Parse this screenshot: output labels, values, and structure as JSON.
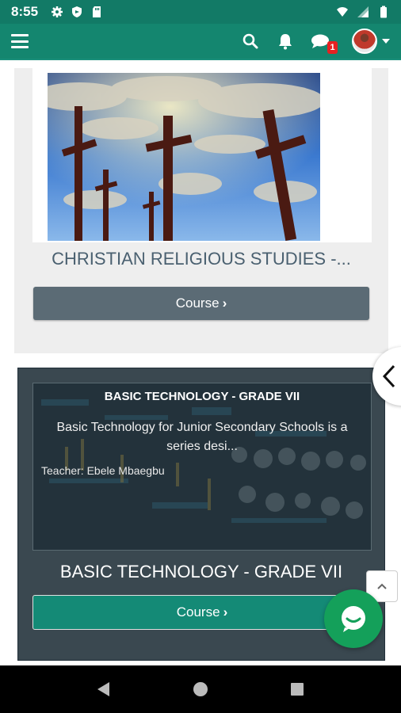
{
  "status_bar": {
    "time": "8:55"
  },
  "header": {
    "message_badge": "1"
  },
  "courses": [
    {
      "title": "CHRISTIAN RELIGIOUS STUDIES -...",
      "button_label": "Course"
    },
    {
      "title": "BASIC TECHNOLOGY - GRADE VII",
      "overlay_title": "BASIC TECHNOLOGY - GRADE VII",
      "overlay_description": "Basic Technology for Junior Secondary Schools is a series desi...",
      "overlay_teacher": "Teacher: Ebele Mbaegbu",
      "button_label": "Course"
    }
  ],
  "icons": {
    "status": [
      "settings-icon",
      "shield-icon",
      "sd-card-icon",
      "wifi-icon",
      "signal-icon",
      "battery-icon"
    ],
    "header": [
      "menu-icon",
      "search-icon",
      "bell-icon",
      "chat-icon",
      "avatar",
      "caret-down-icon"
    ],
    "floating": [
      "chevron-left-icon",
      "chevron-up-icon",
      "chat-bubble-icon"
    ],
    "nav": [
      "back-icon",
      "home-icon",
      "recents-icon"
    ]
  },
  "colors": {
    "header": "#14866f",
    "status_bar": "#127a66",
    "course_button_grey": "#5b6b75",
    "course_button_teal": "#148a76",
    "card_dark": "#3a4850",
    "chat_bubble": "#14a05a",
    "badge": "#e52222"
  }
}
